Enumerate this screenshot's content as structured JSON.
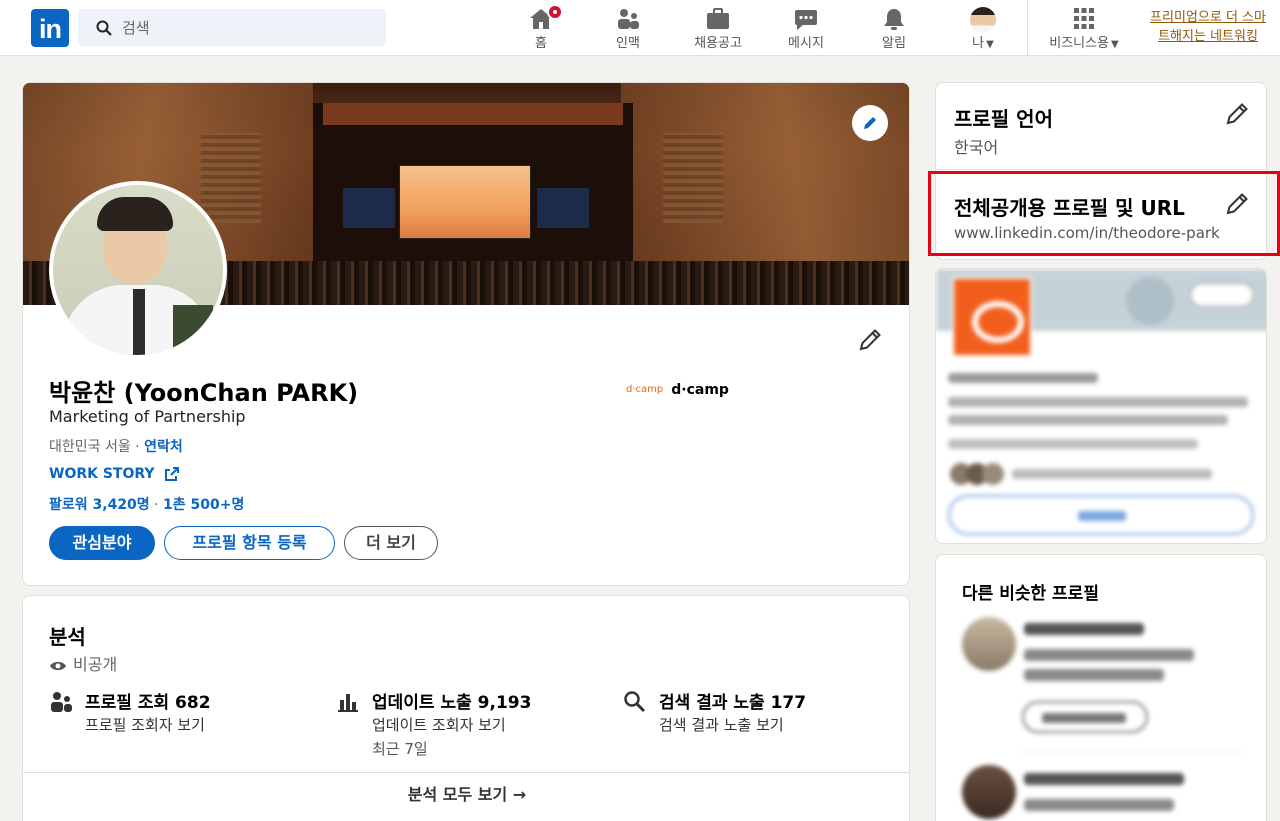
{
  "nav": {
    "logo_text": "in",
    "search_placeholder": "검색",
    "items": [
      {
        "label": "홈",
        "icon": "home-icon"
      },
      {
        "label": "인맥",
        "icon": "network-icon"
      },
      {
        "label": "채용공고",
        "icon": "jobs-icon"
      },
      {
        "label": "메시지",
        "icon": "messaging-icon"
      },
      {
        "label": "알림",
        "icon": "bell-icon"
      },
      {
        "label": "나",
        "icon": "me-avatar"
      }
    ],
    "business_label": "비즈니스용",
    "premium_line1": "프리미엄으로 더 스마",
    "premium_line2": "트해지는 네트워킹"
  },
  "profile": {
    "name": "박윤찬 (YoonChan PARK)",
    "headline": "Marketing of Partnership",
    "location": "대한민국 서울 · ",
    "contact_label": "연락처",
    "website_label": "WORK STORY",
    "followers": "팔로워 3,420명",
    "connections_sep": " · ",
    "connections": "1촌 500+명",
    "company_logo_text": "d·camp",
    "company_name": "d·camp",
    "buttons": {
      "open_to": "관심분야",
      "add_section": "프로필 항목 등록",
      "more": "더 보기"
    }
  },
  "analytics": {
    "title": "분석",
    "visibility": "비공개",
    "stats": [
      {
        "title": "프로필 조회 682",
        "sub": "프로필 조회자 보기",
        "sub2": ""
      },
      {
        "title": "업데이트 노출 9,193",
        "sub": "업데이트 조회자 보기",
        "sub2": "최근 7일"
      },
      {
        "title": "검색 결과 노출 177",
        "sub": "검색 결과 노출 보기",
        "sub2": ""
      }
    ],
    "footer": "분석 모두 보기 →"
  },
  "sidebar": {
    "language_title": "프로필 언어",
    "language_value": "한국어",
    "public_title": "전체공개용 프로필 및 URL",
    "public_url": "www.linkedin.com/in/theodore-park",
    "similar_title": "다른 비슷한 프로필"
  },
  "colors": {
    "brand": "#0a66c2",
    "highlight": "#e60012",
    "premium": "#915907"
  }
}
